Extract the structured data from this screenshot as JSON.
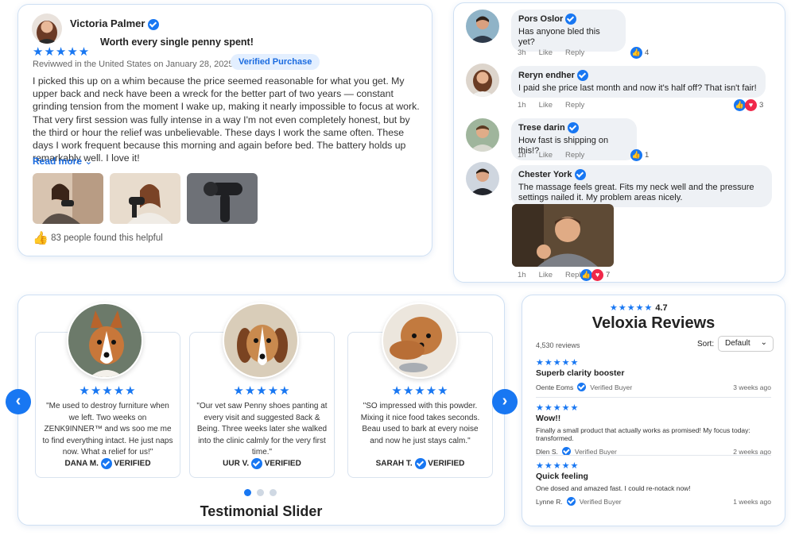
{
  "review": {
    "name": "Victoria Palmer",
    "title": "Worth every single penny spent!",
    "stars": "★★★★★",
    "reviewed": "Reviwwed in the   United States on January 28, 2025",
    "badge": "Verified Purchase",
    "body": "I picked this up on a whim because the price seemed reasonable for what you get. My upper back and neck have been a wreck for the better part of two years — constant grinding tension from the moment I wake up, making it nearly impossible to focus at work. That very first session was fully intense in a way I'm not even completely honest, but by the third or hour the relief was unbelievable. These days I work the same often. These days I work frequent because this morning and again before bed. The battery holds up remarkably well. I love it!",
    "read_more": "Read more",
    "helpful": "83 people found this helpful"
  },
  "comments": [
    {
      "name": "Pors Oslor",
      "text": "Has anyone bled this yet?",
      "time": "3h",
      "like": "Like",
      "reply": "Reply",
      "count": "4"
    },
    {
      "name": "Reryn endher",
      "text": "I paid she price last month and now it's half off? That isn't fair!",
      "time": "1h",
      "like": "Like",
      "reply": "Reply",
      "count": "3"
    },
    {
      "name": "Trese darin",
      "text": "How fast is shipping on this!?",
      "time": "1h",
      "like": "Like",
      "reply": "Reply",
      "count": "1"
    },
    {
      "name": "Chester York",
      "text": "The massage feels great. Fits my neck well and the pressure settings nailed it. My problem areas nicely.",
      "time": "1h",
      "like": "Like",
      "reply": "Reply",
      "count": "7"
    }
  ],
  "slider": {
    "title": "Testimonial Slider",
    "stars": "★★★★★",
    "items": [
      {
        "quote": "\"Me used to destroy furniture when we left. Two weeks on ZENK9INNER™ and ws soo me me to find everything intact. He just naps now. What a relief for us!\"",
        "who": "DANA M.",
        "verified": "VERIFIED"
      },
      {
        "quote": "\"Our vet saw Penny shoes panting at every visit and suggested 8ack & Being. Three weeks later she walked into the clinic calmly for the very first time.\"",
        "who": "UUR V.",
        "verified": "VERIFIED"
      },
      {
        "quote": "\"SO impressed with this powder. Mixing it nice food takes seconds. Beau used to bark at every noise and now he just stays calm.\"",
        "who": "SARAH T.",
        "verified": "VERIFIED"
      }
    ]
  },
  "veloxia": {
    "stars": "★★★★★",
    "rating": "4.7",
    "title": "Veloxia Reviews",
    "count": "4,530 reviews",
    "sort_label": "Sort:",
    "sort_value": "Default",
    "items": [
      {
        "stars": "★★★★★",
        "title": "Superb clarity booster",
        "body": "",
        "name": "Oente Eoms",
        "badge": "Verified Buyer",
        "ago": "3 weeks ago"
      },
      {
        "stars": "★★★★★",
        "title": "Wow!!",
        "body": "Finally a small product that actually works as promised! My focus today: transformed.",
        "name": "Dlen S.",
        "badge": "Verified Buyer",
        "ago": "2 weeks ago"
      },
      {
        "stars": "★★★★★",
        "title": "Quick feeling",
        "body": "One dosed and amazed fast. I could re-notack now!",
        "name": "Lynne R.",
        "badge": "Verified Buyer",
        "ago": "1 weeks ago"
      }
    ]
  },
  "colors": {
    "accent": "#1877f2",
    "love": "#f0284a",
    "border": "#cfe0f3"
  }
}
